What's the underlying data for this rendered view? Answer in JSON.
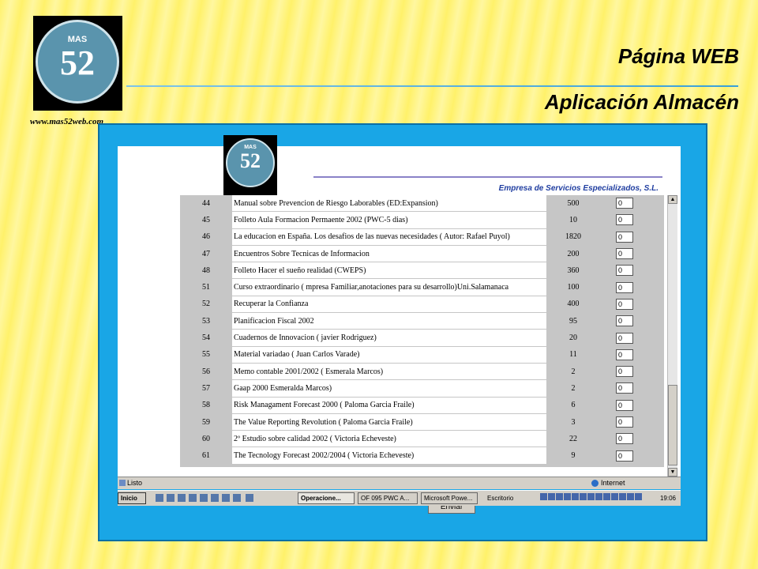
{
  "slide": {
    "title_web": "Página WEB",
    "title_app": "Aplicación Almacén",
    "site_url": "www.mas52web.com",
    "logo_top": "MAS",
    "logo_number": "52"
  },
  "page": {
    "logo_top": "MAS",
    "logo_number": "52",
    "company": "Empresa de Servicios Especializados, S.L.",
    "send_button": "Enviar"
  },
  "items": [
    {
      "id": "44",
      "desc": "Manual sobre Prevencion de Riesgo Laborables (ED:Expansion)",
      "qty": "500",
      "value": "0"
    },
    {
      "id": "45",
      "desc": "Folleto Aula Formacion Permaente 2002 (PWC-5 dias)",
      "qty": "10",
      "value": "0"
    },
    {
      "id": "46",
      "desc": "La educacion en España. Los desafios de las nuevas necesidades ( Autor: Rafael Puyol)",
      "qty": "1820",
      "value": "0"
    },
    {
      "id": "47",
      "desc": "Encuentros Sobre Tecnicas de Informacion",
      "qty": "200",
      "value": "0"
    },
    {
      "id": "48",
      "desc": "Folleto Hacer el sueño realidad (CWEPS)",
      "qty": "360",
      "value": "0"
    },
    {
      "id": "51",
      "desc": "Curso extraordinario ( mpresa Familiar,anotaciones para su desarrollo)Uni.Salamanaca",
      "qty": "100",
      "value": "0"
    },
    {
      "id": "52",
      "desc": "Recuperar la Confianza",
      "qty": "400",
      "value": "0"
    },
    {
      "id": "53",
      "desc": "Planificacion Fiscal 2002",
      "qty": "95",
      "value": "0"
    },
    {
      "id": "54",
      "desc": "Cuadernos de Innovacion ( javier Rodriguez)",
      "qty": "20",
      "value": "0"
    },
    {
      "id": "55",
      "desc": "Material variadao ( Juan Carlos Varade)",
      "qty": "11",
      "value": "0"
    },
    {
      "id": "56",
      "desc": "Memo contable 2001/2002 ( Esmerala Marcos)",
      "qty": "2",
      "value": "0"
    },
    {
      "id": "57",
      "desc": "Gaap 2000 Esmeralda Marcos)",
      "qty": "2",
      "value": "0"
    },
    {
      "id": "58",
      "desc": "Risk Managament Forecast 2000 ( Paloma Garcia Fraile)",
      "qty": "6",
      "value": "0"
    },
    {
      "id": "59",
      "desc": "The Value Reporting Revolution ( Paloma Garcia Fraile)",
      "qty": "3",
      "value": "0"
    },
    {
      "id": "60",
      "desc": "2º Estudio sobre calidad 2002 ( Victoria Echeveste)",
      "qty": "22",
      "value": "0"
    },
    {
      "id": "61",
      "desc": "The Tecnology Forecast 2002/2004 ( Victoria Echeveste)",
      "qty": "9",
      "value": "0"
    }
  ],
  "status": {
    "left": "Listo",
    "zone": "Internet"
  },
  "taskbar": {
    "start": "Inicio",
    "tasks": [
      "Operacione...",
      "OF 095 PWC A...",
      "Microsoft Powe..."
    ],
    "desktop": "Escritorio",
    "clock": "19:06"
  }
}
